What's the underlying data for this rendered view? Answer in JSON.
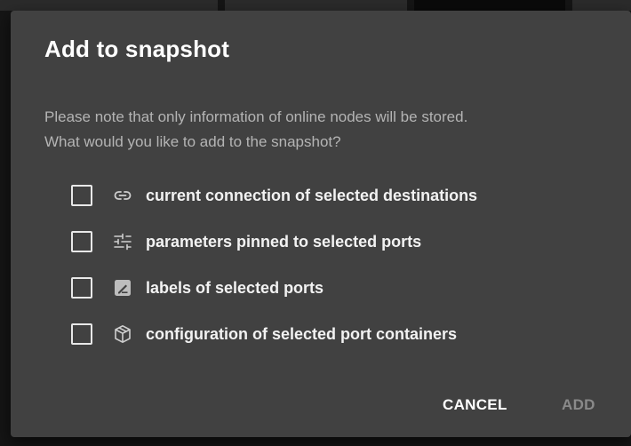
{
  "dialog": {
    "title": "Add to snapshot",
    "description_line1": "Please note that only information of online nodes will be stored.",
    "description_line2": "What would you like to add to the snapshot?",
    "options": [
      {
        "label": "current connection of selected destinations",
        "icon": "link-icon",
        "checked": false
      },
      {
        "label": "parameters pinned to selected ports",
        "icon": "tune-sliders-icon",
        "checked": false
      },
      {
        "label": "labels of selected ports",
        "icon": "label-edit-icon",
        "checked": false
      },
      {
        "label": "configuration of selected port containers",
        "icon": "cube-icon",
        "checked": false
      }
    ],
    "cancel_label": "CANCEL",
    "add_label": "ADD",
    "add_disabled": true
  },
  "colors": {
    "dialog_bg": "#414141",
    "title_text": "#ffffff",
    "description_text": "#b4b4b4",
    "disabled_text": "#8a8a8a"
  }
}
